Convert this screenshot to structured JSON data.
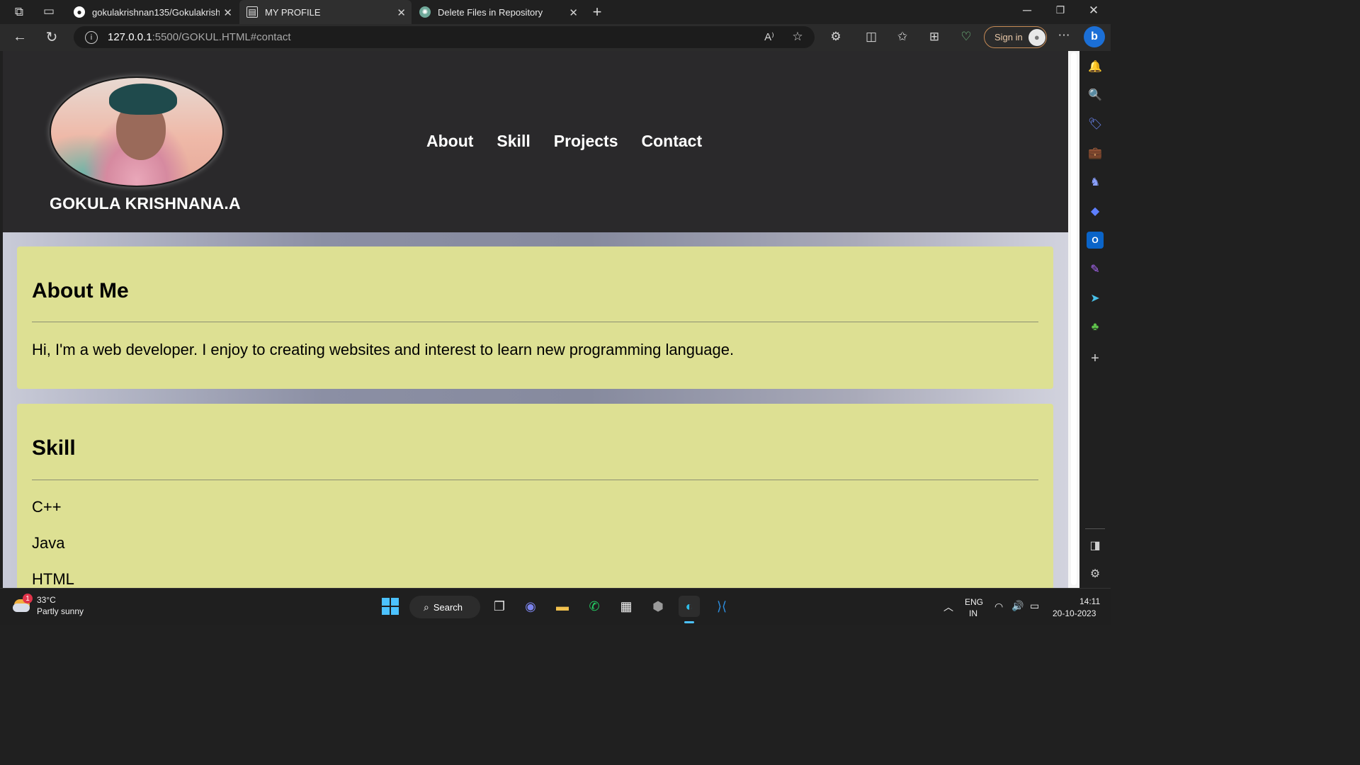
{
  "browser": {
    "tabs": [
      {
        "label": "gokulakrishnan135/Gokulakrishn",
        "icon": "github-icon"
      },
      {
        "label": "MY PROFILE",
        "icon": "page-icon"
      },
      {
        "label": "Delete Files in Repository",
        "icon": "chatgpt-icon"
      }
    ],
    "url_host": "127.0.0.1",
    "url_rest": ":5500/GOKUL.HTML#contact",
    "sign_in": "Sign in"
  },
  "site": {
    "name": "GOKULA KRISHNANA.A",
    "nav": [
      "About",
      "Skill",
      "Projects",
      "Contact"
    ],
    "about": {
      "heading": "About Me",
      "text": "Hi, I'm a web developer. I enjoy to creating websites and interest to learn new programming language."
    },
    "skill": {
      "heading": "Skill",
      "items": [
        "C++",
        "Java",
        "HTML"
      ]
    },
    "colors": {
      "header": "#2a292b",
      "card": "#dde093"
    }
  },
  "taskbar": {
    "weather_temp": "33°C",
    "weather_desc": "Partly sunny",
    "weather_badge": "1",
    "search": "Search",
    "lang_top": "ENG",
    "lang_bottom": "IN",
    "time": "14:11",
    "date": "20-10-2023"
  }
}
